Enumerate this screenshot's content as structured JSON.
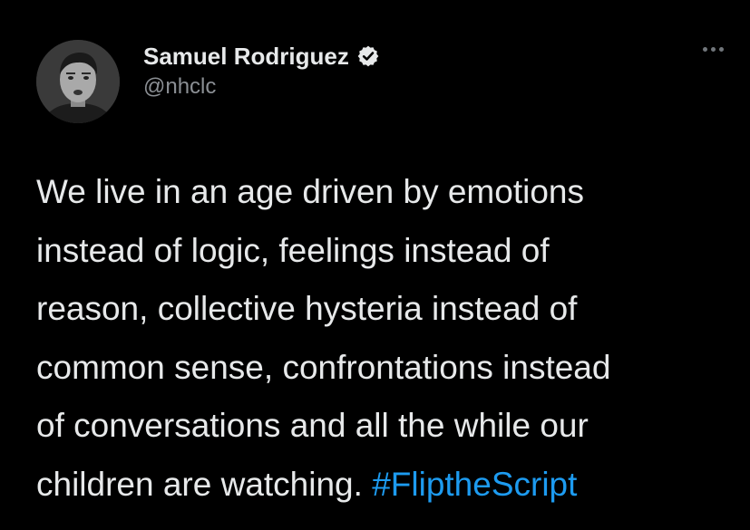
{
  "author": {
    "display_name": "Samuel Rodriguez",
    "handle": "@nhclc",
    "verified_icon": "verified-badge-icon",
    "avatar_icon": "profile-avatar"
  },
  "menu": {
    "more_icon": "more-horizontal-icon"
  },
  "tweet": {
    "lines": [
      "We live in an age driven by emotions",
      "instead of logic, feelings instead of",
      "reason, collective hysteria instead of",
      "common sense, confrontations instead",
      "of conversations and all the while our",
      "children are watching. "
    ],
    "hashtag": "#FliptheScript"
  },
  "colors": {
    "background": "#000000",
    "text": "#e7e9ea",
    "secondary": "#8b8f94",
    "link": "#1d9bf0"
  }
}
